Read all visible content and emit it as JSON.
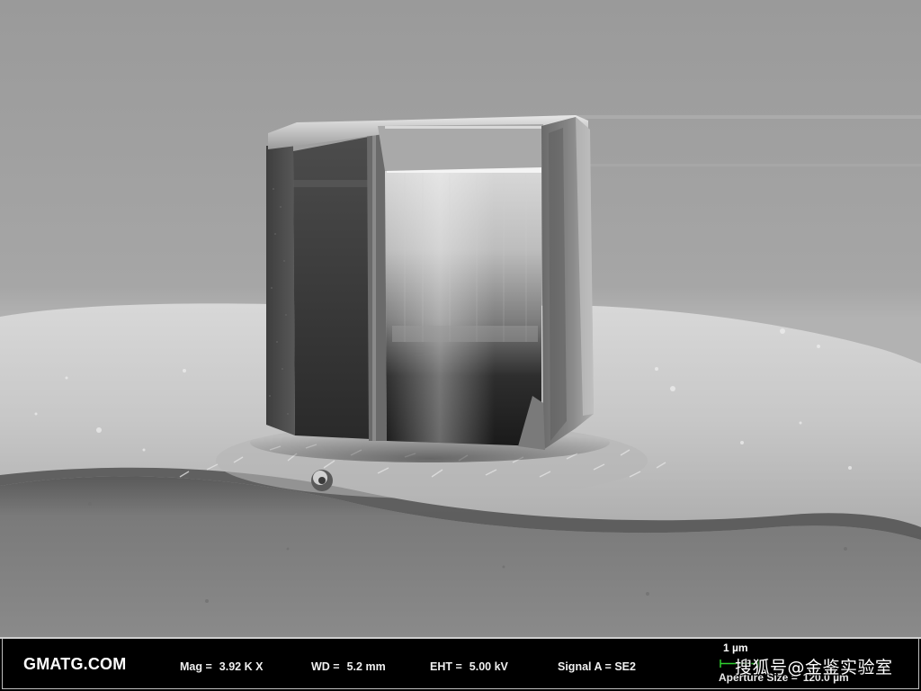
{
  "info_bar": {
    "lab_name": "GMATG.COM",
    "mag_label": "Mag =",
    "mag_value": "3.92 K X",
    "wd_label": "WD =",
    "wd_value": "5.2 mm",
    "eht_label": "EHT =",
    "eht_value": "5.00 kV",
    "signal_label": "Signal A = ",
    "signal_value": "SE2",
    "scale_label": "1 µm",
    "aperture_label": "Aperture Size =",
    "aperture_value": "120.0 µm"
  },
  "watermark": "搜狐号@金鉴实验室",
  "colors": {
    "scale_bar": "#2fd12f",
    "info_text": "#f0f0f0",
    "info_background": "#000000"
  }
}
